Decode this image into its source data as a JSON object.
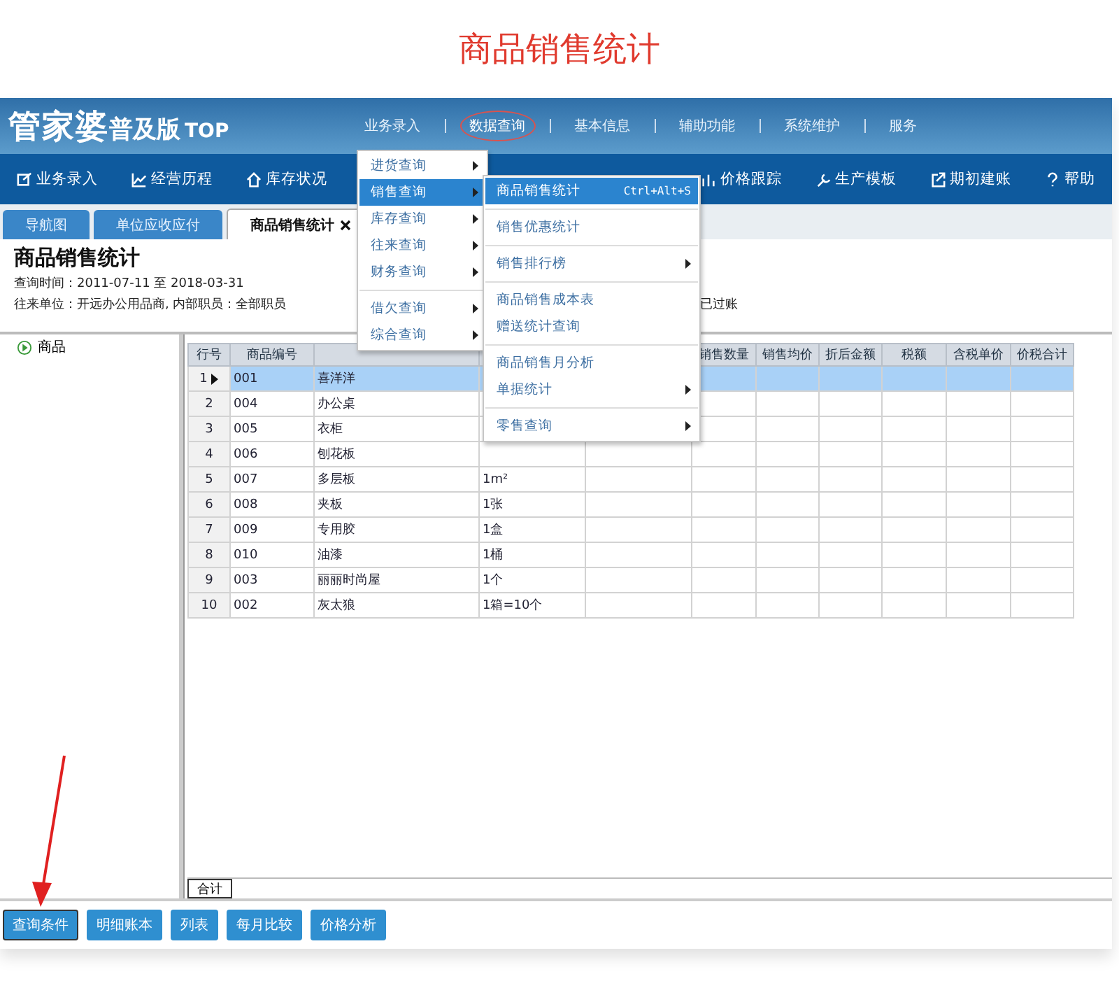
{
  "page_title": "商品销售统计",
  "app": {
    "logo": {
      "name": "管家婆",
      "edition": "普及版",
      "suffix": "TOP"
    },
    "top_menu": [
      {
        "label": "业务录入",
        "selected": false
      },
      {
        "label": "数据查询",
        "selected": true
      },
      {
        "label": "基本信息",
        "selected": false
      },
      {
        "label": "辅助功能",
        "selected": false
      },
      {
        "label": "系统维护",
        "selected": false
      },
      {
        "label": "服务",
        "selected": false
      }
    ],
    "toolbar": [
      {
        "label": "业务录入"
      },
      {
        "label": "经营历程"
      },
      {
        "label": "库存状况"
      },
      {
        "label": "价格跟踪"
      },
      {
        "label": "生产模板"
      },
      {
        "label": "期初建账"
      },
      {
        "label": "帮助"
      }
    ],
    "tabs": [
      {
        "label": "导航图",
        "selected": false,
        "closable": false
      },
      {
        "label": "单位应收应付",
        "selected": false,
        "closable": false
      },
      {
        "label": "商品销售统计",
        "selected": true,
        "closable": true
      }
    ],
    "report": {
      "title": "商品销售统计",
      "period": "查询时间：2011-07-11 至 2018-03-31",
      "filter": "往来单位：开远办公用品商,  内部职员：全部职员",
      "posted": "已过账"
    },
    "tree": [
      {
        "label": "商品",
        "expanded": false
      }
    ],
    "grid": {
      "columns": [
        "行号",
        "商品编号",
        "",
        "",
        "",
        "销售数量",
        "销售均价",
        "折后金额",
        "税额",
        "含税单价",
        "价税合计"
      ],
      "rows": [
        {
          "no": "1",
          "code": "001",
          "name": "喜洋洋",
          "selected": true
        },
        {
          "no": "2",
          "code": "004",
          "name": "办公桌",
          "selected": false
        },
        {
          "no": "3",
          "code": "005",
          "name": "衣柜",
          "selected": false
        },
        {
          "no": "4",
          "code": "006",
          "name": "刨花板",
          "selected": false
        },
        {
          "no": "5",
          "code": "007",
          "name": "多层板",
          "unit": "1m²",
          "selected": false
        },
        {
          "no": "6",
          "code": "008",
          "name": "夹板",
          "unit": "1张",
          "selected": false
        },
        {
          "no": "7",
          "code": "009",
          "name": "专用胶",
          "unit": "1盒",
          "selected": false
        },
        {
          "no": "8",
          "code": "010",
          "name": "油漆",
          "unit": "1桶",
          "selected": false
        },
        {
          "no": "9",
          "code": "003",
          "name": "丽丽时尚屋",
          "unit": "1个",
          "selected": false
        },
        {
          "no": "10",
          "code": "002",
          "name": "灰太狼",
          "unit": "1箱=10个",
          "selected": false
        }
      ],
      "footer": "合计"
    },
    "buttons": [
      {
        "label": "查询条件",
        "selected": true
      },
      {
        "label": "明细账本",
        "selected": false
      },
      {
        "label": "列表",
        "selected": false
      },
      {
        "label": "每月比较",
        "selected": false
      },
      {
        "label": "价格分析",
        "selected": false
      }
    ],
    "menu": [
      {
        "kind": "item",
        "label": "进货查询",
        "submenu": true,
        "selected": false
      },
      {
        "kind": "item",
        "label": "销售查询",
        "submenu": true,
        "selected": true
      },
      {
        "kind": "item",
        "label": "库存查询",
        "submenu": true,
        "selected": false
      },
      {
        "kind": "item",
        "label": "往来查询",
        "submenu": true,
        "selected": false
      },
      {
        "kind": "item",
        "label": "财务查询",
        "submenu": true,
        "selected": false
      },
      {
        "kind": "separator"
      },
      {
        "kind": "item",
        "label": "借欠查询",
        "submenu": true,
        "selected": false
      },
      {
        "kind": "item",
        "label": "综合查询",
        "submenu": true,
        "selected": false
      }
    ],
    "submenu": [
      {
        "kind": "item",
        "label": "商品销售统计",
        "shortcut": "Ctrl+Alt+S",
        "submenu": false,
        "selected": true
      },
      {
        "kind": "separator"
      },
      {
        "kind": "item",
        "label": "销售优惠统计",
        "submenu": false,
        "selected": false
      },
      {
        "kind": "separator"
      },
      {
        "kind": "item",
        "label": "销售排行榜",
        "submenu": true,
        "selected": false
      },
      {
        "kind": "separator"
      },
      {
        "kind": "item",
        "label": "商品销售成本表",
        "submenu": false,
        "selected": false
      },
      {
        "kind": "item",
        "label": "赠送统计查询",
        "submenu": false,
        "selected": false
      },
      {
        "kind": "separator"
      },
      {
        "kind": "item",
        "label": "商品销售月分析",
        "submenu": false,
        "selected": false
      },
      {
        "kind": "item",
        "label": "单据统计",
        "submenu": true,
        "selected": false
      },
      {
        "kind": "separator"
      },
      {
        "kind": "item",
        "label": "零售查询",
        "submenu": true,
        "selected": false
      }
    ]
  }
}
